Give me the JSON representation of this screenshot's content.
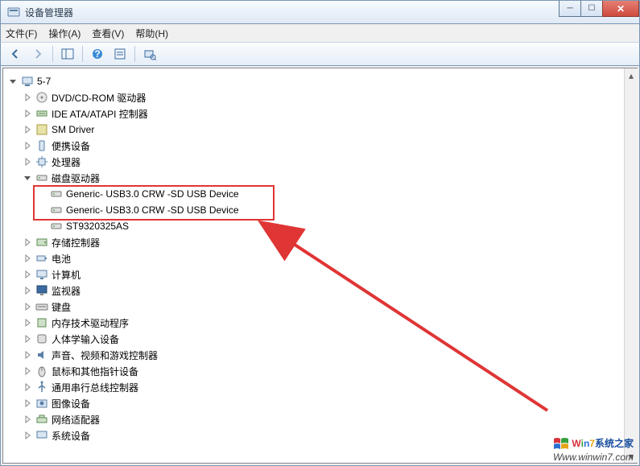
{
  "window": {
    "title": "设备管理器"
  },
  "menu": {
    "file": "文件(F)",
    "action": "操作(A)",
    "view": "查看(V)",
    "help": "帮助(H)"
  },
  "tree": {
    "root": {
      "label": "5-7"
    },
    "items": [
      {
        "key": "dvd",
        "label": "DVD/CD-ROM 驱动器"
      },
      {
        "key": "ide",
        "label": "IDE ATA/ATAPI 控制器"
      },
      {
        "key": "sm",
        "label": "SM Driver"
      },
      {
        "key": "portable",
        "label": "便携设备"
      },
      {
        "key": "cpu",
        "label": "处理器"
      },
      {
        "key": "disk",
        "label": "磁盘驱动器",
        "expanded": true,
        "children": [
          {
            "key": "usb1",
            "label": "Generic-  USB3.0 CRW   -SD USB Device",
            "highlight": true
          },
          {
            "key": "usb2",
            "label": "Generic-  USB3.0 CRW   -SD USB Device",
            "highlight": true
          },
          {
            "key": "st",
            "label": "ST9320325AS"
          }
        ]
      },
      {
        "key": "storage",
        "label": "存储控制器"
      },
      {
        "key": "battery",
        "label": "电池"
      },
      {
        "key": "computer",
        "label": "计算机"
      },
      {
        "key": "monitor",
        "label": "监视器"
      },
      {
        "key": "keyboard",
        "label": "键盘"
      },
      {
        "key": "memtech",
        "label": "内存技术驱动程序"
      },
      {
        "key": "hid",
        "label": "人体学输入设备"
      },
      {
        "key": "sound",
        "label": "声音、视频和游戏控制器"
      },
      {
        "key": "mouse",
        "label": "鼠标和其他指针设备"
      },
      {
        "key": "usb",
        "label": "通用串行总线控制器"
      },
      {
        "key": "imaging",
        "label": "图像设备"
      },
      {
        "key": "network",
        "label": "网络适配器"
      },
      {
        "key": "system",
        "label": "系统设备"
      }
    ]
  },
  "watermark": {
    "brand_prefix": "Win7",
    "brand_suffix": "系统之家",
    "url": "Www.winwin7.com"
  }
}
